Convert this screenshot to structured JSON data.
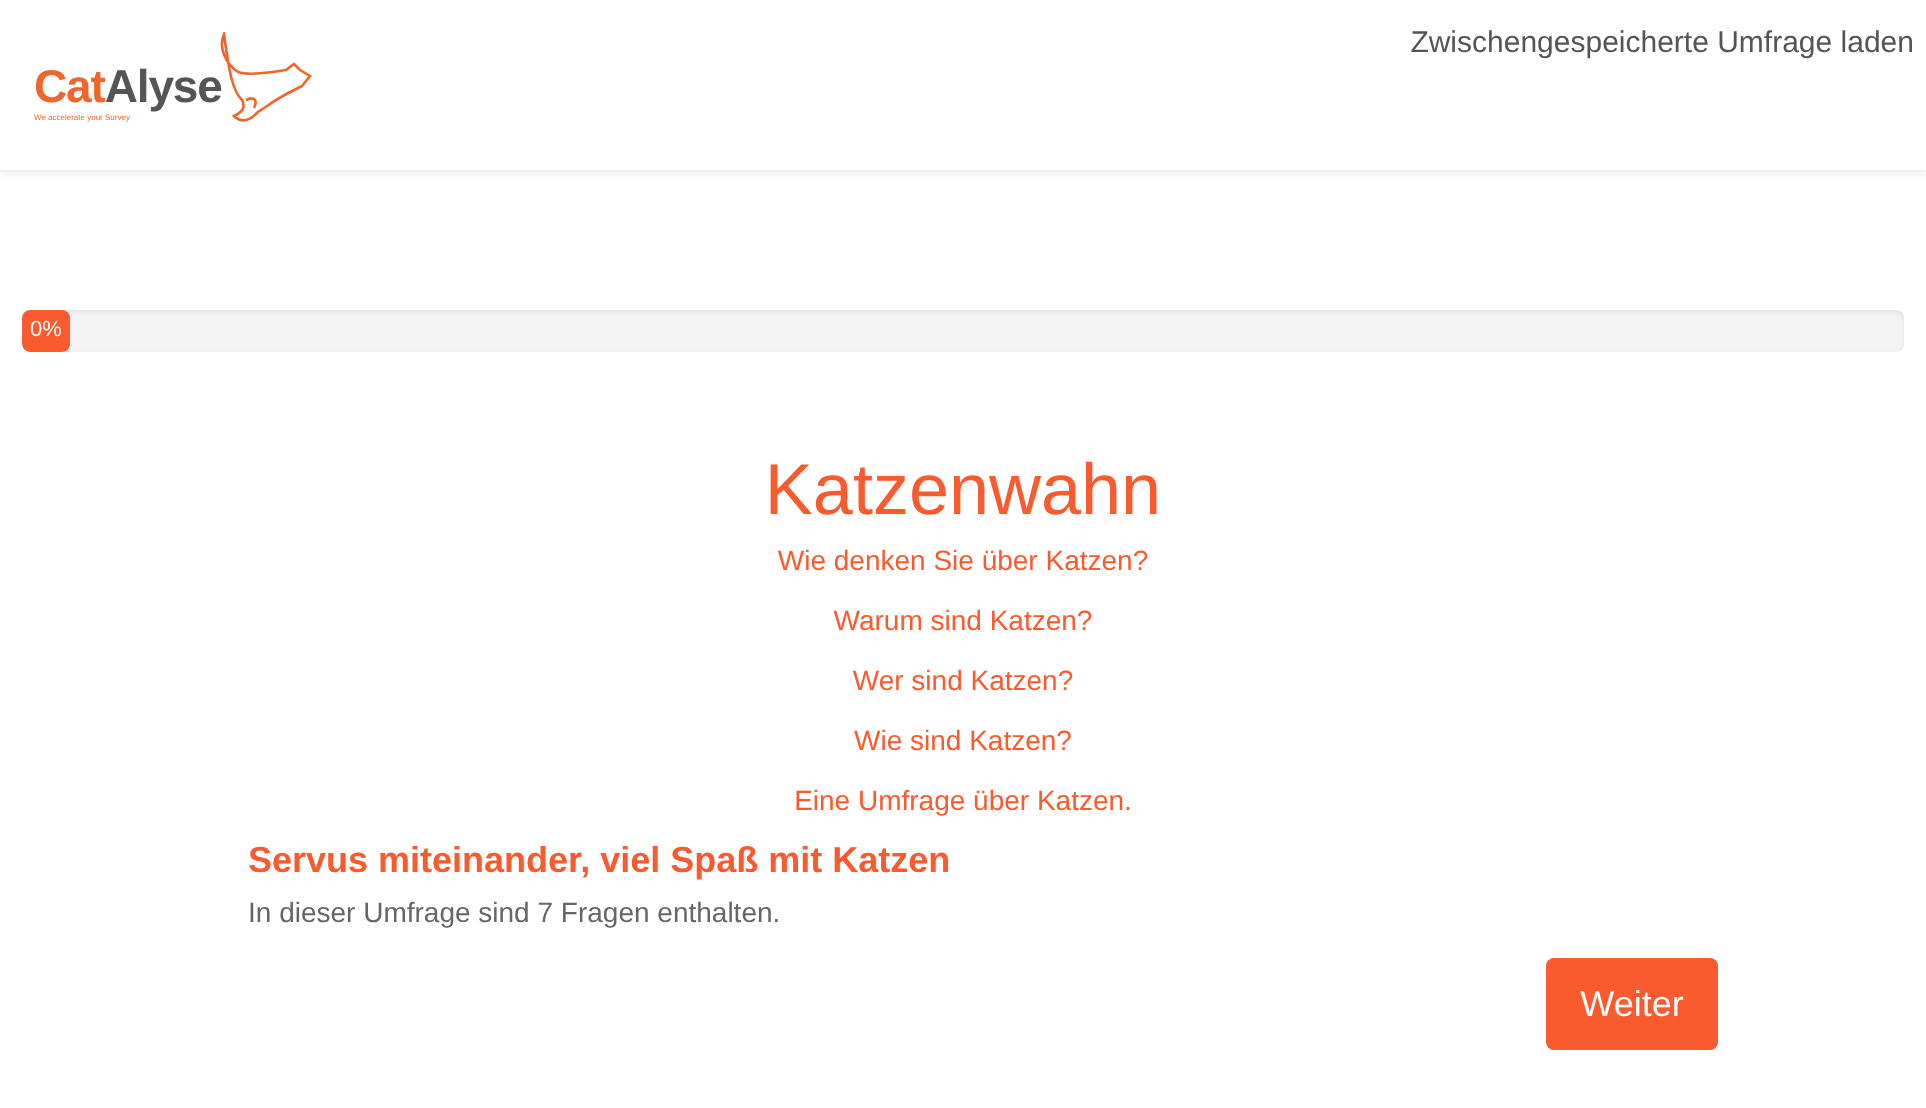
{
  "header": {
    "logo": {
      "name_start": "Cat",
      "name_end": "Alyse",
      "tagline": "We accelerate your Survey"
    },
    "load_link": "Zwischengespeicherte Umfrage laden"
  },
  "progress": {
    "level": 0,
    "label": "0%"
  },
  "survey": {
    "title": "Katzenwahn",
    "description_lines": [
      "Wie denken Sie über Katzen?",
      "Warum sind Katzen?",
      "Wer sind Katzen?",
      "Wie sind Katzen?",
      "Eine Umfrage über Katzen."
    ],
    "welcome_heading": "Servus miteinander, viel Spaß mit Katzen",
    "question_count_text": "In dieser Umfrage sind 7 Fragen enthalten."
  },
  "buttons": {
    "next": "Weiter"
  }
}
